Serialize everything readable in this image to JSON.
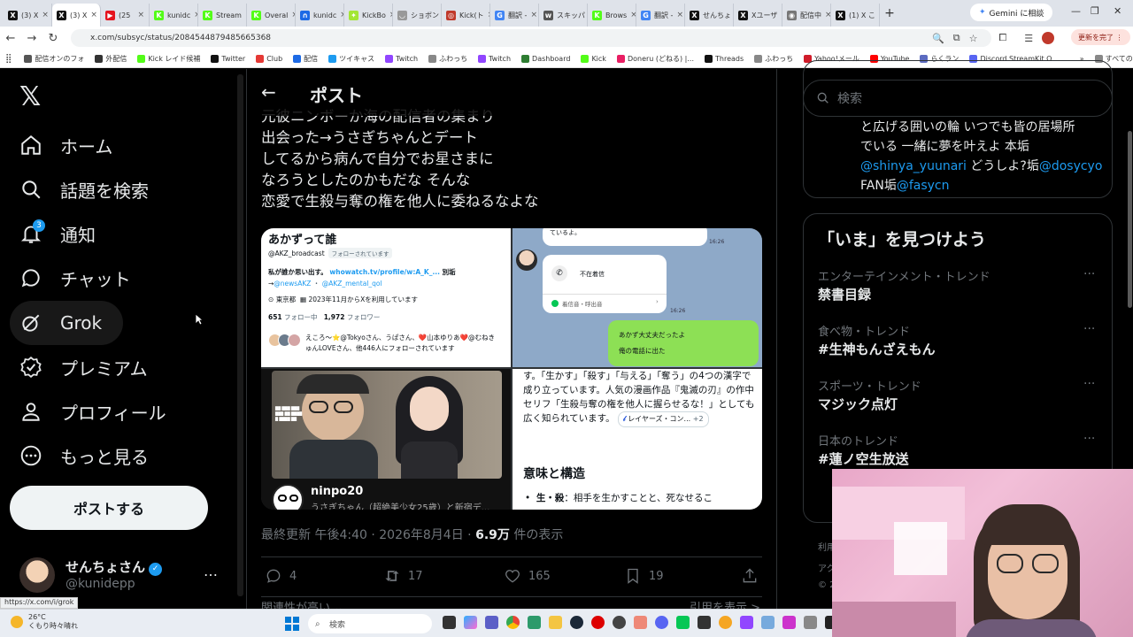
{
  "browser": {
    "tabs": [
      {
        "label": "(3) X",
        "color": "#111111",
        "glyph": "X"
      },
      {
        "label": "(3) X",
        "color": "#111111",
        "glyph": "X",
        "active": true
      },
      {
        "label": "(25",
        "color": "#e5141e",
        "glyph": "▶"
      },
      {
        "label": "kunidc",
        "color": "#53fc18",
        "glyph": "K"
      },
      {
        "label": "Stream",
        "color": "#53fc18",
        "glyph": "K"
      },
      {
        "label": "Overal",
        "color": "#53fc18",
        "glyph": "K"
      },
      {
        "label": "kunidc",
        "color": "#1d6ae5",
        "glyph": "∩"
      },
      {
        "label": "KickBo",
        "color": "#a3e635",
        "glyph": "✦"
      },
      {
        "label": "ショボン",
        "color": "#999999",
        "glyph": "◡"
      },
      {
        "label": "Kick(ト",
        "color": "#c0392b",
        "glyph": "◎"
      },
      {
        "label": "翻訳 -",
        "color": "#4285f4",
        "glyph": "G"
      },
      {
        "label": "スキッパ",
        "color": "#555555",
        "glyph": "w"
      },
      {
        "label": "Brows",
        "color": "#53fc18",
        "glyph": "K"
      },
      {
        "label": "翻訳 -",
        "color": "#4285f4",
        "glyph": "G"
      },
      {
        "label": "せんちょ",
        "color": "#111111",
        "glyph": "X"
      },
      {
        "label": "Xユーザ",
        "color": "#111111",
        "glyph": "X"
      },
      {
        "label": "配信中",
        "color": "#777777",
        "glyph": "◉"
      },
      {
        "label": "(1) X こ",
        "color": "#111111",
        "glyph": "X"
      }
    ],
    "new_tab": "+",
    "gemini_label": "Gemini に相談",
    "url": "x.com/subsyc/status/2084544879485665368",
    "update_label": "更新を完了 ⋮",
    "bookmarks": [
      {
        "label": "配信オンのフォ",
        "color": "#555555"
      },
      {
        "label": "外配信",
        "color": "#333333"
      },
      {
        "label": "Kick レイド候補",
        "color": "#53fc18"
      },
      {
        "label": "Twitter",
        "color": "#111111"
      },
      {
        "label": "Club",
        "color": "#e53935"
      },
      {
        "label": "配信",
        "color": "#1d6ae5"
      },
      {
        "label": "ツイキャス",
        "color": "#1d9bf0"
      },
      {
        "label": "Twitch",
        "color": "#9146ff"
      },
      {
        "label": "ふわっち",
        "color": "#888888"
      },
      {
        "label": "Twitch",
        "color": "#9146ff"
      },
      {
        "label": "Dashboard",
        "color": "#2e7d32"
      },
      {
        "label": "Kick",
        "color": "#53fc18"
      },
      {
        "label": "Doneru (どねる) |...",
        "color": "#e91e63"
      },
      {
        "label": "Threads",
        "color": "#111111"
      },
      {
        "label": "ふわっち",
        "color": "#888888"
      },
      {
        "label": "Yahoo!メール",
        "color": "#d01c2a"
      },
      {
        "label": "YouTube",
        "color": "#ff0000"
      },
      {
        "label": "らくラン",
        "color": "#5c6bc0"
      },
      {
        "label": "Discord StreamKit O...",
        "color": "#5865f2"
      },
      {
        "label": "»",
        "color": "#ffffff"
      },
      {
        "label": "すべてのブックマーク",
        "color": "#888888"
      }
    ]
  },
  "leftnav": {
    "items": [
      {
        "label": "ホーム",
        "icon": "home-icon"
      },
      {
        "label": "話題を検索",
        "icon": "search-icon"
      },
      {
        "label": "通知",
        "icon": "bell-icon"
      },
      {
        "label": "チャット",
        "icon": "chat-icon"
      },
      {
        "label": "Grok",
        "icon": "grok-icon"
      },
      {
        "label": "プレミアム",
        "icon": "premium-icon"
      },
      {
        "label": "プロフィール",
        "icon": "profile-icon"
      },
      {
        "label": "もっと見る",
        "icon": "more-icon"
      }
    ],
    "notif_badge": "3",
    "post_button": "ポストする",
    "account": {
      "name": "せんちょさん",
      "handle": "@kunidepp",
      "more": "…"
    },
    "status_url": "https://x.com/i/grok"
  },
  "main": {
    "header_title": "ポスト",
    "text_lines": [
      "元彼ニンボーか海の配信者の集まり",
      "出会った→うさぎちゃんとデート",
      "してるから病んで自分でお星さまに",
      "なろうとしたのかもだな そんな",
      "恋愛で生殺与奪の権を他人に委ねるなよな"
    ],
    "media": {
      "profile_card": {
        "name": "あかずって誰",
        "handle": "@AKZ_broadcast",
        "follows_you": "フォローされています",
        "bio": "私が誰か思い出す。",
        "link": "whowatch.tv/profile/w:A_K_...",
        "alias": "別垢",
        "arrow": "→",
        "mention1": "@newsAKZ",
        "sep": "・",
        "mention2": "@AKZ_mental_qol",
        "location": "東京都",
        "joined": "2023年11月からXを利用しています",
        "following_count": "651",
        "following_label": "フォロー中",
        "followers_count": "1,972",
        "followers_label": "フォロワー",
        "followed_by_1": "えころ〜⭐@Tokyoさん、うぱさん、❤️山本ゆりあ❤️@むねき",
        "followed_by_2": "ゅんLOVEさん、他446人にフォローされています"
      },
      "chat": {
        "top_text": "よ。",
        "top_text_2": "ているよ。",
        "time1": "16:26",
        "missed_call": "不在着信",
        "callback": "着信音・呼出音",
        "time2": "16:26",
        "green_1": "あかず大丈夫だったよ",
        "green_2": "俺の電話に出た"
      },
      "video": {
        "channel": "ninpo20",
        "caption": "うさぎちゃん（超絶美少女25歳）と新宿デ..."
      },
      "grok_answer": {
        "text": "す。「生かす」「殺す」「与える」「奪う」の4つの漢字で成り立っています。人気の漫画作品『鬼滅の刃』の作中セリフ「生殺与奪の権を他人に握らせるな！」としても広く知られています。",
        "chip": "レイヤーズ・コン...",
        "chip_more": "+2",
        "heading": "意味と構造",
        "bullet_term": "生・殺",
        "bullet_text": "：相手を生かすことと、死なせるこ"
      }
    },
    "meta": {
      "prefix": "最終更新",
      "time": "午後4:40",
      "sep": "·",
      "date": "2026年8月4日",
      "views": "6.9万",
      "views_label": "件の表示"
    },
    "actions": {
      "replies": "4",
      "reposts": "17",
      "likes": "165",
      "bookmarks": "19"
    },
    "related": "関連性が高い ⌄",
    "quote_view": "引用を表示 >"
  },
  "right": {
    "search_placeholder": "検索",
    "bio_lines": [
      "と広げる囲いの輪 いつでも皆の居場所",
      "でいる 一緒に夢を叶えよ 本垢",
      "@shinya_yuunari どうしよ?垢@dosycyo",
      "FAN垢@fasycn"
    ],
    "explore_title": "「いま」を見つけよう",
    "trends": [
      {
        "category": "エンターテインメント・トレンド",
        "name": "禁書目録"
      },
      {
        "category": "食べ物・トレンド",
        "name": "#生神もんざえもん"
      },
      {
        "category": "スポーツ・トレンド",
        "name": "マジック点灯"
      },
      {
        "category": "日本のトレンド",
        "name": "#蓮ノ空生放送"
      }
    ],
    "more_dots": "···",
    "footer_1": "利用",
    "footer_2": "アク",
    "footer_3": "© 2"
  },
  "taskbar": {
    "temperature": "26°C",
    "weather": "くもり時々晴れ",
    "search": "検索"
  }
}
